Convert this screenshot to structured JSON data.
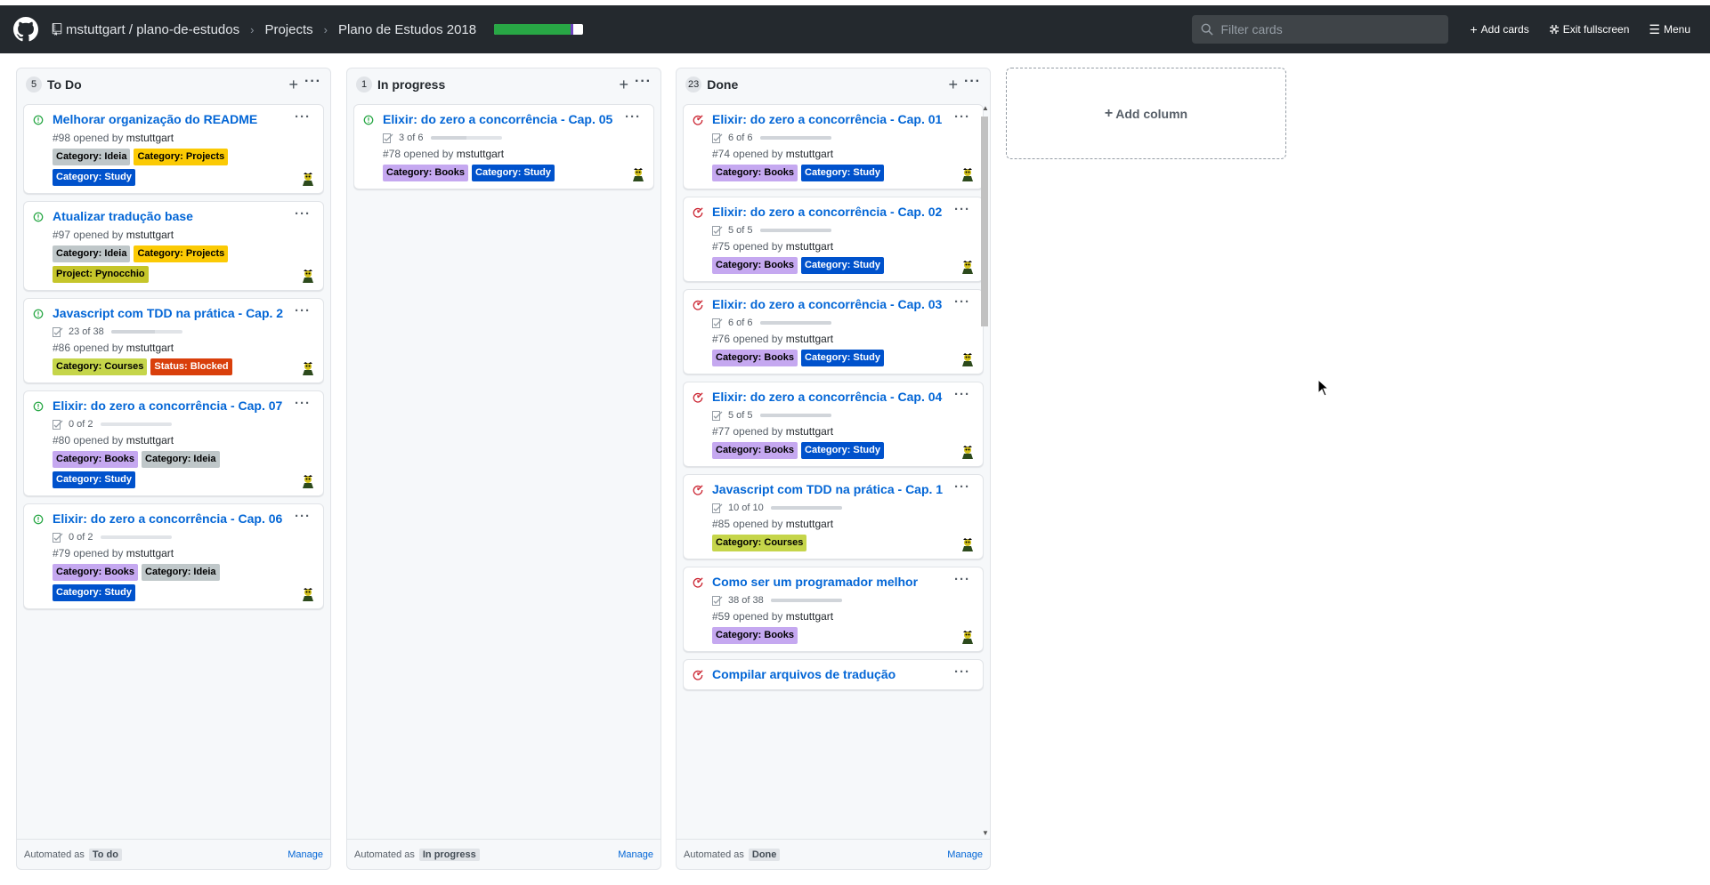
{
  "header": {
    "repo_owner_path": "mstuttgart / plano-de-estudos",
    "crumb_projects": "Projects",
    "crumb_project": "Plano de Estudos 2018",
    "project_progress": {
      "done_fraction": 0.86,
      "in_progress_fraction": 0.03
    },
    "filter_placeholder": "Filter cards",
    "add_cards": "Add cards",
    "exit_fullscreen": "Exit fullscreen",
    "menu": "Menu"
  },
  "label_colors": {
    "Category: Ideia": {
      "bg": "#bfc7c9",
      "fg": "#000000"
    },
    "Category: Projects": {
      "bg": "#fbca04",
      "fg": "#000000"
    },
    "Category: Study": {
      "bg": "#0052cc",
      "fg": "#ffffff"
    },
    "Project: Pynocchio": {
      "bg": "#c5c52a",
      "fg": "#000000"
    },
    "Category: Courses": {
      "bg": "#c5d54a",
      "fg": "#000000"
    },
    "Status: Blocked": {
      "bg": "#d93f0b",
      "fg": "#ffffff"
    },
    "Category: Books": {
      "bg": "#c5a8f0",
      "fg": "#000000"
    }
  },
  "columns": [
    {
      "name": "To Do",
      "count": "5",
      "automated_prefix": "Automated as",
      "automation": "To do",
      "manage": "Manage",
      "cards": [
        {
          "title": "Melhorar organização do README",
          "number": "#98",
          "opened": "opened by",
          "user": "mstuttgart",
          "state": "open",
          "labels": [
            "Category: Ideia",
            "Category: Projects",
            "Category: Study"
          ]
        },
        {
          "title": "Atualizar tradução base",
          "number": "#97",
          "opened": "opened by",
          "user": "mstuttgart",
          "state": "open",
          "labels": [
            "Category: Ideia",
            "Category: Projects",
            "Project: Pynocchio"
          ]
        },
        {
          "title": "Javascript com TDD na prática - Cap. 2",
          "number": "#86",
          "opened": "opened by",
          "user": "mstuttgart",
          "state": "open",
          "tasks": "23 of 38",
          "task_fraction": 0.61,
          "labels": [
            "Category: Courses",
            "Status: Blocked"
          ]
        },
        {
          "title": "Elixir: do zero a concorrência - Cap. 07",
          "number": "#80",
          "opened": "opened by",
          "user": "mstuttgart",
          "state": "open",
          "tasks": "0 of 2",
          "task_fraction": 0,
          "labels": [
            "Category: Books",
            "Category: Ideia",
            "Category: Study"
          ]
        },
        {
          "title": "Elixir: do zero a concorrência - Cap. 06",
          "number": "#79",
          "opened": "opened by",
          "user": "mstuttgart",
          "state": "open",
          "tasks": "0 of 2",
          "task_fraction": 0,
          "labels": [
            "Category: Books",
            "Category: Ideia",
            "Category: Study"
          ]
        }
      ]
    },
    {
      "name": "In progress",
      "count": "1",
      "automated_prefix": "Automated as",
      "automation": "In progress",
      "manage": "Manage",
      "cards": [
        {
          "title": "Elixir: do zero a concorrência - Cap. 05",
          "number": "#78",
          "opened": "opened by",
          "user": "mstuttgart",
          "state": "open",
          "tasks": "3 of 6",
          "task_fraction": 0.5,
          "labels": [
            "Category: Books",
            "Category: Study"
          ]
        }
      ]
    },
    {
      "name": "Done",
      "count": "23",
      "automated_prefix": "Automated as",
      "automation": "Done",
      "manage": "Manage",
      "cards": [
        {
          "title": "Elixir: do zero a concorrência - Cap. 01",
          "number": "#74",
          "opened": "opened by",
          "user": "mstuttgart",
          "state": "closed",
          "tasks": "6 of 6",
          "task_fraction": 1,
          "labels": [
            "Category: Books",
            "Category: Study"
          ]
        },
        {
          "title": "Elixir: do zero a concorrência - Cap. 02",
          "number": "#75",
          "opened": "opened by",
          "user": "mstuttgart",
          "state": "closed",
          "tasks": "5 of 5",
          "task_fraction": 1,
          "labels": [
            "Category: Books",
            "Category: Study"
          ]
        },
        {
          "title": "Elixir: do zero a concorrência - Cap. 03",
          "number": "#76",
          "opened": "opened by",
          "user": "mstuttgart",
          "state": "closed",
          "tasks": "6 of 6",
          "task_fraction": 1,
          "labels": [
            "Category: Books",
            "Category: Study"
          ]
        },
        {
          "title": "Elixir: do zero a concorrência - Cap. 04",
          "number": "#77",
          "opened": "opened by",
          "user": "mstuttgart",
          "state": "closed",
          "tasks": "5 of 5",
          "task_fraction": 1,
          "labels": [
            "Category: Books",
            "Category: Study"
          ]
        },
        {
          "title": "Javascript com TDD na prática - Cap. 1",
          "number": "#85",
          "opened": "opened by",
          "user": "mstuttgart",
          "state": "closed",
          "tasks": "10 of 10",
          "task_fraction": 1,
          "labels": [
            "Category: Courses"
          ]
        },
        {
          "title": "Como ser um programador melhor",
          "number": "#59",
          "opened": "opened by",
          "user": "mstuttgart",
          "state": "closed",
          "tasks": "38 of 38",
          "task_fraction": 1,
          "labels": [
            "Category: Books"
          ]
        },
        {
          "title": "Compilar arquivos de tradução",
          "state": "closed"
        }
      ]
    }
  ],
  "add_column": "Add column"
}
